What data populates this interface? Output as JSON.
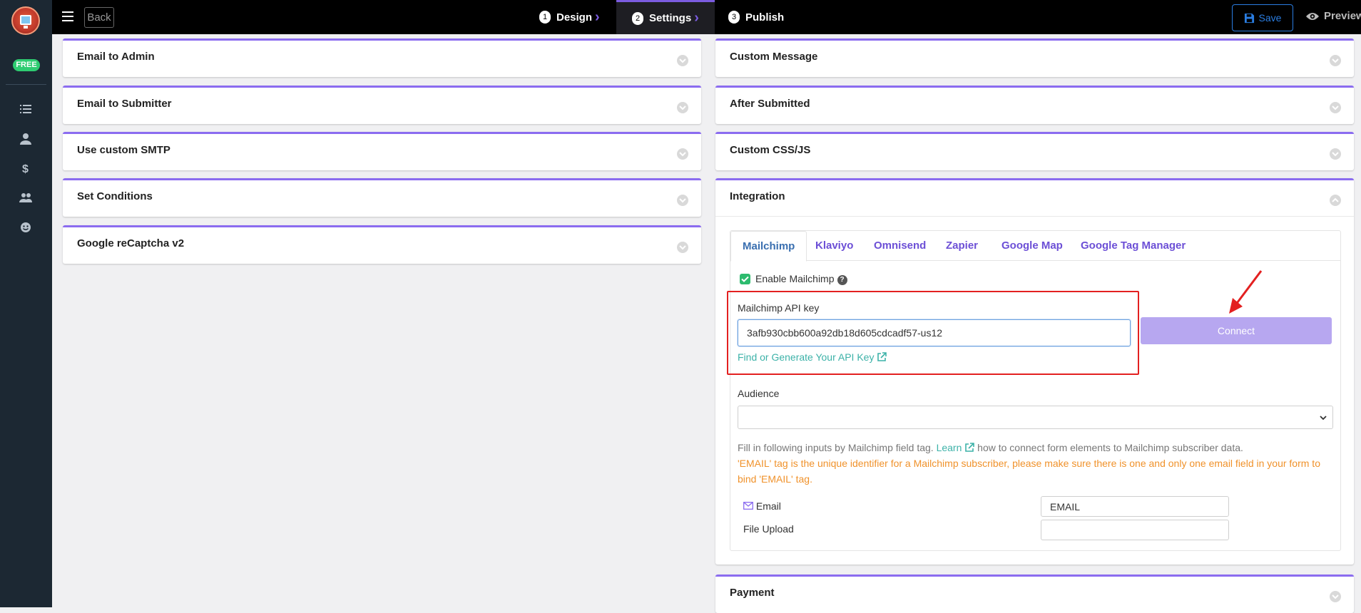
{
  "sidebar": {
    "badge": "FREE",
    "icons": [
      "list-icon",
      "user-icon",
      "dollar-icon",
      "users-icon",
      "smile-icon"
    ]
  },
  "topbar": {
    "back_label": "Back",
    "steps": [
      {
        "num": "1",
        "label": "Design"
      },
      {
        "num": "2",
        "label": "Settings"
      },
      {
        "num": "3",
        "label": "Publish"
      }
    ],
    "active_step": "Settings",
    "save_label": "Save",
    "preview_label": "Preview"
  },
  "left_panels": [
    "Email to Admin",
    "Email to Submitter",
    "Use custom SMTP",
    "Set Conditions",
    "Google reCaptcha v2"
  ],
  "right_panels": {
    "custom_message": "Custom Message",
    "after_submitted": "After Submitted",
    "custom_css_js": "Custom CSS/JS",
    "integration": "Integration",
    "payment": "Payment"
  },
  "integration": {
    "tabs": [
      "Mailchimp",
      "Klaviyo",
      "Omnisend",
      "Zapier",
      "Google Map",
      "Google Tag Manager"
    ],
    "active_tab": "Mailchimp",
    "enable_label": "Enable Mailchimp",
    "enable_checked": true,
    "help_icon": "?",
    "api_key_label": "Mailchimp API key",
    "api_key_value": "3afb930cbb600a92db18d605cdcadf57-us12",
    "find_key_link": "Find or Generate Your API Key",
    "connect_label": "Connect",
    "audience_label": "Audience",
    "audience_value": "",
    "note_prefix": "Fill in following inputs by Mailchimp field tag.",
    "note_learn": "Learn",
    "note_suffix": "how to connect form elements to Mailchimp subscriber data.",
    "warning": "'EMAIL' tag is the unique identifier for a Mailchimp subscriber, please make sure there is one and only one email field in your form to bind 'EMAIL' tag.",
    "fields": [
      {
        "label": "Email",
        "tag": "EMAIL"
      },
      {
        "label": "File Upload",
        "tag": ""
      }
    ]
  },
  "colors": {
    "accent": "#8b6cf0",
    "link": "#3cb2a8",
    "warning": "#f0922b",
    "highlight": "#e32020"
  }
}
